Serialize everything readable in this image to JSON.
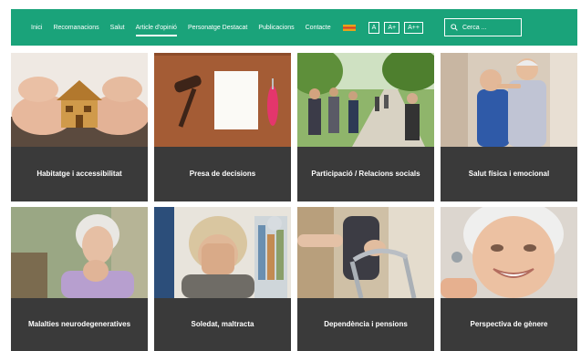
{
  "nav": {
    "items": [
      {
        "label": "Inici"
      },
      {
        "label": "Recomanacions"
      },
      {
        "label": "Salut"
      },
      {
        "label": "Article d'opinió",
        "active": true
      },
      {
        "label": "Personatge Destacat"
      },
      {
        "label": "Publicacions"
      },
      {
        "label": "Contacte"
      }
    ],
    "font_sizes": [
      "A",
      "A+",
      "A++"
    ],
    "search_placeholder": "Cerca ...",
    "accent_color": "#1aa37a"
  },
  "cards": [
    {
      "title": "Habitatge i accessibilitat",
      "image": "hands-holding-wooden-house"
    },
    {
      "title": "Presa de decisions",
      "image": "gavel-paper-and-pen"
    },
    {
      "title": "Participació / Relacions socials",
      "image": "group-walking-in-park"
    },
    {
      "title": "Salut física i emocional",
      "image": "elderly-couple-dancing"
    },
    {
      "title": "Malalties neurodegeneratives",
      "image": "pensive-elderly-woman"
    },
    {
      "title": "Soledat, maltracta",
      "image": "woman-covering-face"
    },
    {
      "title": "Dependència i pensions",
      "image": "walker-assistance"
    },
    {
      "title": "Perspectiva de gènere",
      "image": "smiling-elderly-woman"
    }
  ]
}
